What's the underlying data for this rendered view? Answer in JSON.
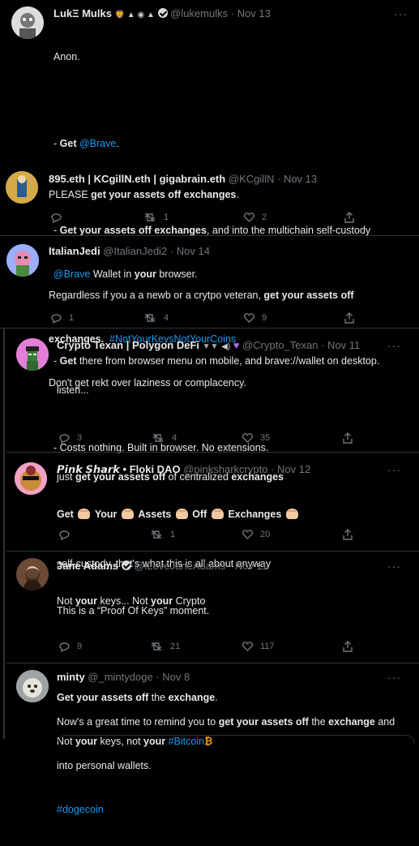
{
  "tweets": [
    {
      "name": "LukΞ Mulks",
      "badges": "🦁 ▲ ◉ ▲",
      "handle": "@lukemulks",
      "date": "· Nov 13",
      "lines": [
        "Anon.",
        "",
        "- Get @Brave.",
        "",
        "- Get your assets off exchanges, and into the multichain self-custody",
        "@Brave Wallet in your browser.",
        "",
        "- Get there from browser menu on mobile, and brave://wallet on desktop.",
        "",
        "- Costs nothing. Built in browser. No extensions."
      ]
    },
    {
      "name": "895.eth | KCgillN.eth | gigabrain.eth",
      "handle": "@KCgillN",
      "date": "· Nov 13",
      "text": "PLEASE get your assets off exchanges.",
      "replies": "",
      "retweets": "1",
      "likes": "2"
    },
    {
      "name": "ItalianJedi",
      "handle": "@ItalianJedi2",
      "date": "· Nov 14",
      "line1": "Regardless if you a a newb or a crytpo veteran, get your assets off",
      "line2a": "exchanges.",
      "hashtag": "#NotYourKeysNotYourCoins",
      "line3": "Don't get rekt over laziness or complacency.",
      "replies": "1",
      "retweets": "4",
      "likes": "9"
    },
    {
      "name": "Crypto Texan | Polygon DeFi",
      "handle": "@Crypto_Texan",
      "date": "· Nov 11",
      "line1": "listen...",
      "line2": "just get your assets off of centralized exchanges",
      "line3": "self-custody, that's what this is all about anyway",
      "replies": "3",
      "retweets": "4",
      "likes": "35"
    },
    {
      "name": "𝙋𝙞𝙣𝙠 𝙎𝙝𝙖𝙧𝙠 • Floki DAO",
      "handle": "@pinksharkcrypto",
      "date": "· Nov 12",
      "words": [
        "Get",
        "Your",
        "Assets",
        "Off",
        "Exchanges"
      ],
      "line2": "Not your keys... Not your Crypto",
      "replies": "",
      "retweets": "1",
      "likes": "20"
    },
    {
      "name": "Jane Adams",
      "handle": "@iLoveJaneAdams",
      "date": "· Nov 11",
      "line1": "This is a “Proof Of Keys” moment.",
      "line2": "Get your assets off the exchange.",
      "line3": "Not your keys, not your",
      "hashtag": "#Bitcoin",
      "replies": "9",
      "retweets": "21",
      "likes": "117"
    },
    {
      "name": "minty",
      "handle": "@_mintydoge",
      "date": "· Nov 8",
      "line1": "Now's a great time to remind you to get your assets off the exchange and",
      "line2": "into personal wallets.",
      "hashtag": "#dogecoin"
    }
  ],
  "ui": {
    "more": "···",
    "accent": "#1d9bf0",
    "bg": "#000000"
  }
}
